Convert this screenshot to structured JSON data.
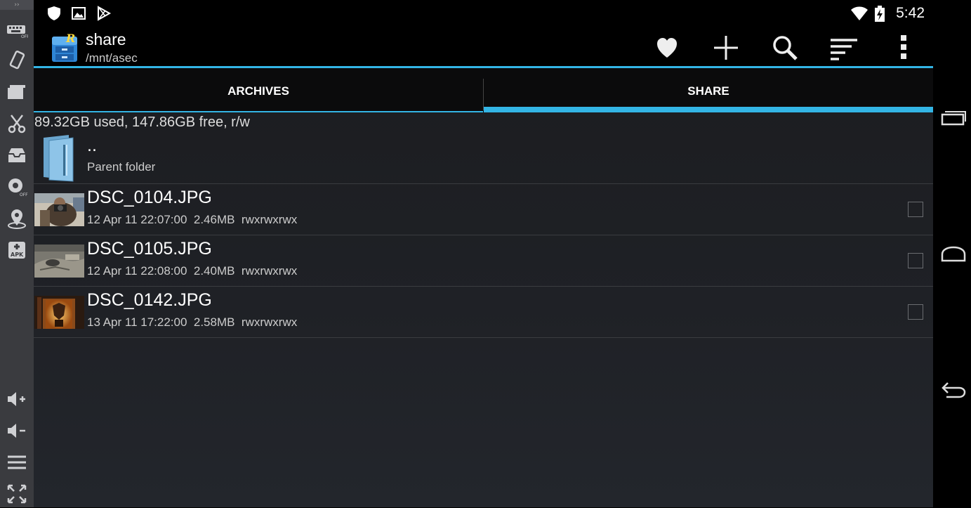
{
  "status_bar": {
    "left_icons": [
      "shield-icon",
      "image-icon",
      "play-store-icon"
    ],
    "right_icons": [
      "wifi-icon",
      "battery-charging-icon"
    ],
    "time": "5:42"
  },
  "emulator_toolbar": {
    "icons": [
      "keyboard-off-icon",
      "rotate-icon",
      "screenshot-icon",
      "cut-icon",
      "inbox-icon",
      "camera-off-icon",
      "location-icon",
      "apk-install-icon",
      "volume-up-icon",
      "volume-down-icon",
      "menu-icon",
      "fullscreen-icon"
    ]
  },
  "action_bar": {
    "title": "share",
    "subtitle": "/mnt/asec",
    "icons": [
      "favorite-heart-icon",
      "add-icon",
      "search-icon",
      "sort-icon",
      "overflow-menu-icon"
    ],
    "accent_color": "#33b5e5"
  },
  "tabs": [
    {
      "label": "ARCHIVES",
      "selected": false
    },
    {
      "label": "SHARE",
      "selected": true
    }
  ],
  "storage_info": "89.32GB used, 147.86GB free, r/w",
  "parent": {
    "name": "..",
    "label": "Parent folder"
  },
  "files": [
    {
      "name": "DSC_0104.JPG",
      "date": "12 Apr 11 22:07:00",
      "size": "2.46MB",
      "perms": "rwxrwxrwx",
      "checked": false
    },
    {
      "name": "DSC_0105.JPG",
      "date": "12 Apr 11 22:08:00",
      "size": "2.40MB",
      "perms": "rwxrwxrwx",
      "checked": false
    },
    {
      "name": "DSC_0142.JPG",
      "date": "13 Apr 11 17:22:00",
      "size": "2.58MB",
      "perms": "rwxrwxrwx",
      "checked": false
    }
  ],
  "nav_bar": {
    "icons": [
      "recent-apps-icon",
      "home-icon",
      "back-icon"
    ]
  }
}
